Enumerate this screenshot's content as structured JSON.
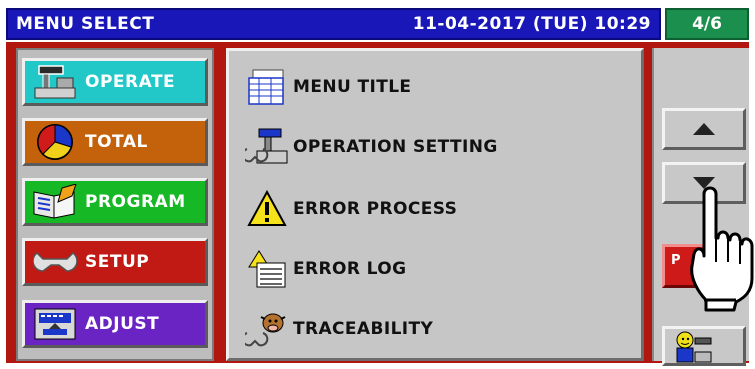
{
  "header": {
    "title": "MENU SELECT",
    "datetime": "11-04-2017 (TUE) 10:29",
    "page_indicator": "4/6"
  },
  "left_menu": [
    {
      "label": "OPERATE",
      "icon": "scale-icon",
      "color": "#22c7c7"
    },
    {
      "label": "TOTAL",
      "icon": "pie-chart-icon",
      "color": "#c4620b"
    },
    {
      "label": "PROGRAM",
      "icon": "book-pencil-icon",
      "color": "#16b825"
    },
    {
      "label": "SETUP",
      "icon": "wrench-icon",
      "color": "#c11a14"
    },
    {
      "label": "ADJUST",
      "icon": "adjust-scale-icon",
      "color": "#6a24c4"
    }
  ],
  "center_items": [
    {
      "label": "MENU TITLE",
      "icon": "menu-title-icon"
    },
    {
      "label": "OPERATION SETTING",
      "icon": "wrench-scale-icon"
    },
    {
      "label": "ERROR PROCESS",
      "icon": "warning-icon"
    },
    {
      "label": "ERROR LOG",
      "icon": "warning-log-icon"
    },
    {
      "label": "TRACEABILITY",
      "icon": "cow-wrench-icon"
    }
  ],
  "right_panel": {
    "up_icon": "triangle-up-icon",
    "down_icon": "triangle-down-icon",
    "red_button_label": "P",
    "bottom_icon": "operator-scale-icon"
  },
  "colors": {
    "header_bg": "#1a17b8",
    "page_indicator_bg": "#1b8f4e",
    "frame_red": "#b1160f"
  }
}
